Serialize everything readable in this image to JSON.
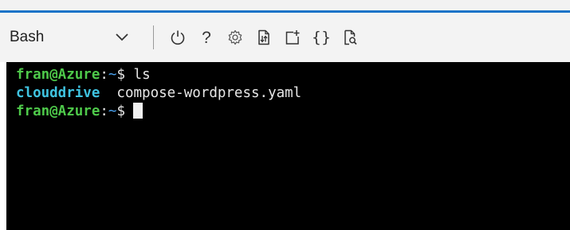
{
  "window": {
    "accent_color": "#1a73c8",
    "toolbar_bg": "#f3f3f3",
    "terminal_bg": "#000000"
  },
  "toolbar": {
    "shell": {
      "label": "Bash",
      "dropdown_icon": "chevron-down-icon"
    },
    "icons": [
      {
        "name": "restart-icon",
        "glyph": "power"
      },
      {
        "name": "help-icon",
        "glyph": "?"
      },
      {
        "name": "settings-icon",
        "glyph": "gear"
      },
      {
        "name": "upload-download-icon",
        "glyph": "file-transfer"
      },
      {
        "name": "new-session-icon",
        "glyph": "new-window"
      },
      {
        "name": "editor-icon",
        "glyph": "{}"
      },
      {
        "name": "web-preview-icon",
        "glyph": "file-search"
      }
    ],
    "help_label": "?",
    "editor_label": "{}"
  },
  "terminal": {
    "colors": {
      "user": "#4ec94a",
      "path": "#4aa3f0",
      "directory": "#3fc3e0",
      "text": "#e8e8e8"
    },
    "lines": [
      {
        "user": "fran@Azure",
        "sep": ":",
        "path": "~",
        "sym": "$",
        "command": " ls"
      },
      {
        "dir": "clouddrive",
        "file": "  compose-wordpress.yaml"
      },
      {
        "user": "fran@Azure",
        "sep": ":",
        "path": "~",
        "sym": "$",
        "command": ""
      }
    ]
  }
}
